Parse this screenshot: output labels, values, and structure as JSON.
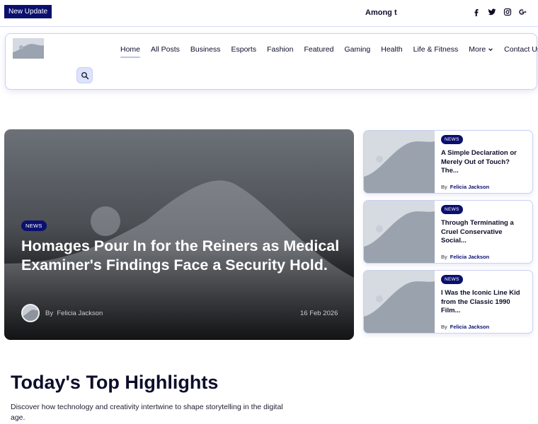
{
  "topbar": {
    "new_update_label": "New Update",
    "ticker_text": "Among t",
    "social_icons": [
      "facebook-icon",
      "twitter-icon",
      "instagram-icon",
      "google-plus-icon"
    ]
  },
  "nav": {
    "items": [
      {
        "label": "Home",
        "active": true
      },
      {
        "label": "All Posts"
      },
      {
        "label": "Business"
      },
      {
        "label": "Esports"
      },
      {
        "label": "Fashion"
      },
      {
        "label": "Featured"
      },
      {
        "label": "Gaming"
      },
      {
        "label": "Health"
      },
      {
        "label": "Life & Fitness"
      },
      {
        "label": "More",
        "has_dropdown": true
      },
      {
        "label": "Contact Us"
      }
    ]
  },
  "hero": {
    "tag": "NEWS",
    "title": "Homages Pour In for the Reiners as Medical Examiner's Findings Face a Security Hold.",
    "by_label": "By",
    "author": "Felicia Jackson",
    "date": "16 Feb 2026"
  },
  "side_posts": [
    {
      "tag": "NEWS",
      "title": "A Simple Declaration or Merely Out of Touch? The...",
      "by_label": "By",
      "author": "Felicia Jackson"
    },
    {
      "tag": "NEWS",
      "title": "Through Terminating a Cruel Conservative Social...",
      "by_label": "By",
      "author": "Felicia Jackson"
    },
    {
      "tag": "NEWS",
      "title": "I Was the Iconic Line Kid from the Classic 1990 Film...",
      "by_label": "By",
      "author": "Felicia Jackson"
    }
  ],
  "highlights": {
    "title": "Today's Top Highlights",
    "description": "Discover how technology and creativity intertwine to shape storytelling in the digital age."
  },
  "colors": {
    "accent": "#0b0f6e",
    "border": "#c9d1f5",
    "text": "#0d0d2b"
  }
}
